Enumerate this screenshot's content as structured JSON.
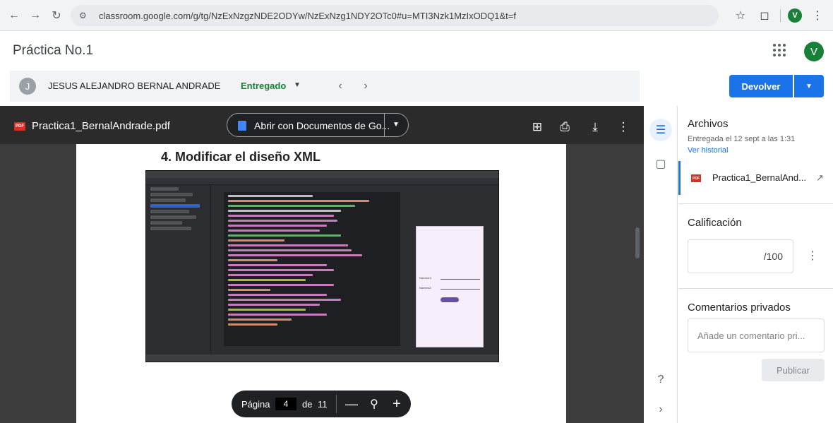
{
  "browser": {
    "url": "classroom.google.com/g/tg/NzExNzgzNDE2ODYw/NzExNzg1NDY2OTc0#u=MTI3Nzk1MzIxODQ1&t=f",
    "profile_initial": "V",
    "icons": [
      "back-arrow-icon",
      "forward-arrow-icon",
      "reload-icon",
      "site-settings-icon",
      "star-icon",
      "extensions-icon",
      "more-vert-icon"
    ]
  },
  "header": {
    "title": "Práctica No.1",
    "avatar_initial": "V"
  },
  "student_bar": {
    "avatar_initial": "J",
    "name": "JESUS ALEJANDRO BERNAL ANDRADE",
    "status": "Entregado",
    "return_label": "Devolver"
  },
  "viewer": {
    "file_name": "Practica1_BernalAndrade.pdf",
    "open_with_label": "Abrir con Documentos de Go...",
    "page_heading": "4. Modificar el diseño XML",
    "page_label": "Página",
    "current_page": "4",
    "of_label": "de",
    "total_pages": "11",
    "embedded": {
      "label_1": "Numero1:",
      "label_2": "Numero2:"
    }
  },
  "panel": {
    "files_title": "Archivos",
    "submitted_text": "Entregada el 12 sept a las 1:31",
    "history_link": "Ver historial",
    "file_name": "Practica1_BernalAnd...",
    "grade_title": "Calificación",
    "grade_denominator": "/100",
    "comments_title": "Comentarios privados",
    "comment_placeholder": "Añade un comentario pri...",
    "publish_label": "Publicar"
  },
  "colors": {
    "primary": "#1a73e8",
    "status_green": "#188038",
    "pdf_red": "#d93025"
  }
}
